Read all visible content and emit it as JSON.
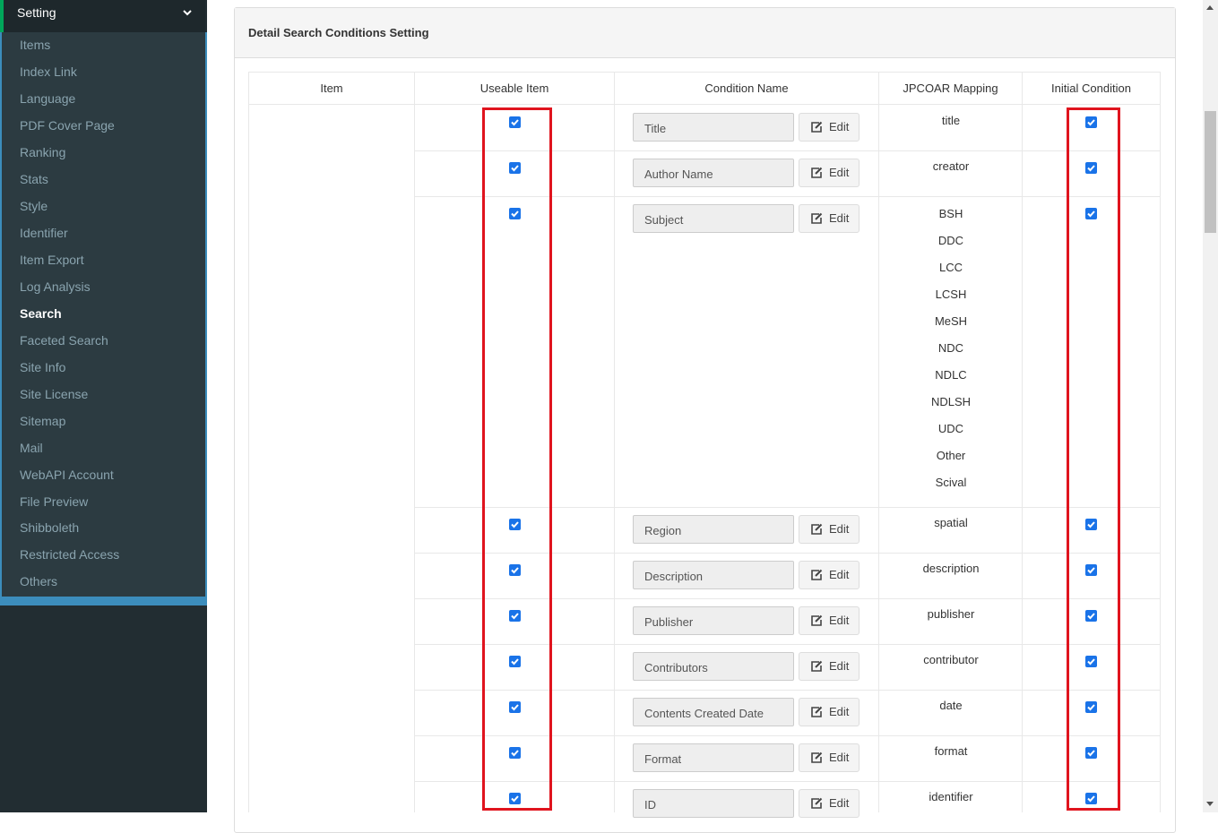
{
  "sidebar": {
    "header": "Setting",
    "items": [
      {
        "label": "Items"
      },
      {
        "label": "Index Link"
      },
      {
        "label": "Language"
      },
      {
        "label": "PDF Cover Page"
      },
      {
        "label": "Ranking"
      },
      {
        "label": "Stats"
      },
      {
        "label": "Style"
      },
      {
        "label": "Identifier"
      },
      {
        "label": "Item Export"
      },
      {
        "label": "Log Analysis"
      },
      {
        "label": "Search",
        "active": true
      },
      {
        "label": "Faceted Search"
      },
      {
        "label": "Site Info"
      },
      {
        "label": "Site License"
      },
      {
        "label": "Sitemap"
      },
      {
        "label": "Mail"
      },
      {
        "label": "WebAPI Account"
      },
      {
        "label": "File Preview"
      },
      {
        "label": "Shibboleth"
      },
      {
        "label": "Restricted Access"
      },
      {
        "label": "Others"
      }
    ]
  },
  "panel": {
    "title": "Detail Search Conditions Setting",
    "columns": [
      "Item",
      "Useable Item",
      "Condition Name",
      "JPCOAR Mapping",
      "Initial Condition"
    ],
    "edit_label": "Edit",
    "rows": [
      {
        "condition": "Title",
        "mapping": [
          "title"
        ],
        "useable": true,
        "initial": true
      },
      {
        "condition": "Author Name",
        "mapping": [
          "creator"
        ],
        "useable": true,
        "initial": true
      },
      {
        "condition": "Subject",
        "mapping": [
          "BSH",
          "DDC",
          "LCC",
          "LCSH",
          "MeSH",
          "NDC",
          "NDLC",
          "NDLSH",
          "UDC",
          "Other",
          "Scival"
        ],
        "useable": true,
        "initial": true
      },
      {
        "condition": "Region",
        "mapping": [
          "spatial"
        ],
        "useable": true,
        "initial": true
      },
      {
        "condition": "Description",
        "mapping": [
          "description"
        ],
        "useable": true,
        "initial": true
      },
      {
        "condition": "Publisher",
        "mapping": [
          "publisher"
        ],
        "useable": true,
        "initial": true
      },
      {
        "condition": "Contributors",
        "mapping": [
          "contributor"
        ],
        "useable": true,
        "initial": true
      },
      {
        "condition": "Contents Created Date",
        "mapping": [
          "date"
        ],
        "useable": true,
        "initial": true
      },
      {
        "condition": "Format",
        "mapping": [
          "format"
        ],
        "useable": true,
        "initial": true
      },
      {
        "condition": "ID",
        "mapping": [
          "identifier"
        ],
        "useable": true,
        "initial": true
      }
    ]
  },
  "colors": {
    "sidebar_bg": "#222d32",
    "accent_blue": "#3c8dbc",
    "highlight_red": "#e0141e",
    "checkbox_blue": "#1a73e8"
  }
}
